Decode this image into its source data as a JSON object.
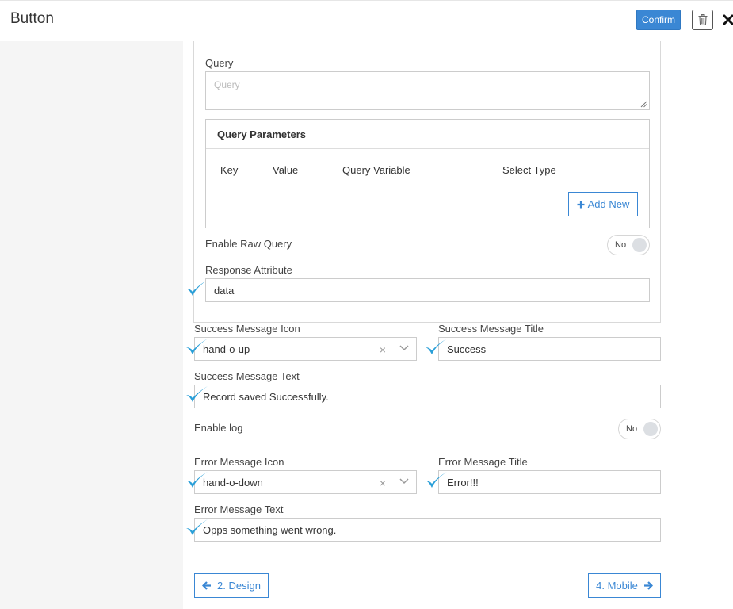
{
  "header": {
    "title": "Button",
    "confirm_label": "Confirm"
  },
  "query": {
    "label": "Query",
    "placeholder": "Query",
    "value": ""
  },
  "query_parameters": {
    "title": "Query Parameters",
    "columns": [
      "Key",
      "Value",
      "Query Variable",
      "Select Type"
    ],
    "add_new_label": "Add New"
  },
  "raw_query": {
    "label": "Enable Raw Query",
    "toggle_text": "No"
  },
  "response_attribute": {
    "label": "Response Attribute",
    "value": "data"
  },
  "success": {
    "icon_label": "Success Message Icon",
    "icon_value": "hand-o-up",
    "title_label": "Success Message Title",
    "title_value": "Success",
    "text_label": "Success Message Text",
    "text_value": "Record saved Successfully."
  },
  "log": {
    "label": "Enable log",
    "toggle_text": "No"
  },
  "error": {
    "icon_label": "Error Message Icon",
    "icon_value": "hand-o-down",
    "title_label": "Error Message Title",
    "title_value": "Error!!!",
    "text_label": "Error Message Text",
    "text_value": "Opps something went wrong."
  },
  "navigation": {
    "prev_label": "2. Design",
    "next_label": "4. Mobile"
  },
  "colors": {
    "accent": "#3a87d4",
    "check": "#2a9fd8"
  }
}
